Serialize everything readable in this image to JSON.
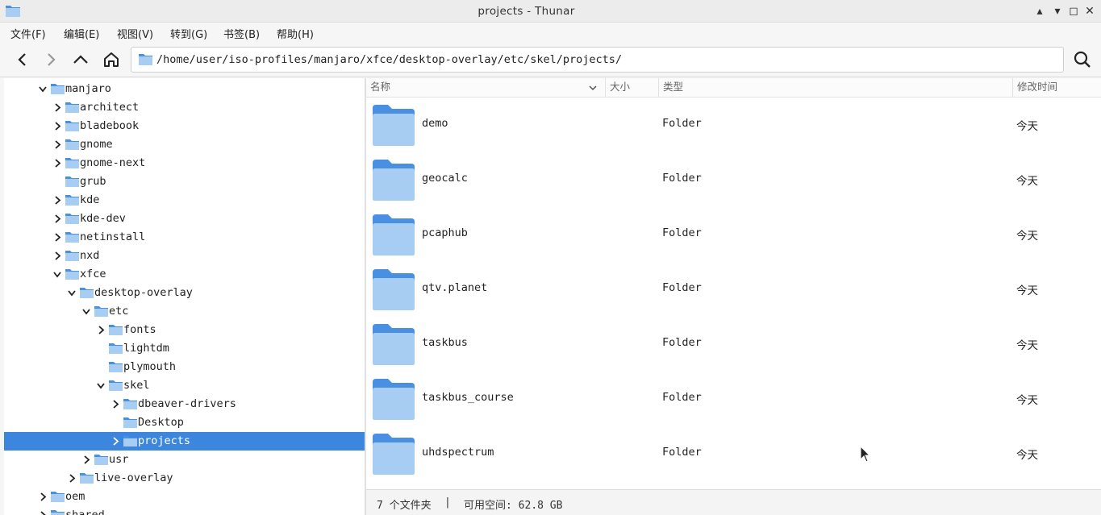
{
  "window": {
    "title": "projects - Thunar",
    "minimize_glyph": "▴",
    "restore_glyph": "▾",
    "maximize_glyph": "◻",
    "close_glyph": "✕"
  },
  "menubar": {
    "items": [
      "文件(F)",
      "编辑(E)",
      "视图(V)",
      "转到(G)",
      "书签(B)",
      "帮助(H)"
    ]
  },
  "toolbar": {
    "path": "/home/user/iso-profiles/manjaro/xfce/desktop-overlay/etc/skel/projects/"
  },
  "tree": {
    "items": [
      {
        "label": "manjaro",
        "state": "expanded"
      },
      {
        "label": "architect",
        "state": "collapsed"
      },
      {
        "label": "bladebook",
        "state": "collapsed"
      },
      {
        "label": "gnome",
        "state": "collapsed"
      },
      {
        "label": "gnome-next",
        "state": "collapsed"
      },
      {
        "label": "grub",
        "state": "leaf"
      },
      {
        "label": "kde",
        "state": "collapsed"
      },
      {
        "label": "kde-dev",
        "state": "collapsed"
      },
      {
        "label": "netinstall",
        "state": "collapsed"
      },
      {
        "label": "nxd",
        "state": "collapsed"
      },
      {
        "label": "xfce",
        "state": "expanded"
      },
      {
        "label": "desktop-overlay",
        "state": "expanded"
      },
      {
        "label": "etc",
        "state": "expanded"
      },
      {
        "label": "fonts",
        "state": "collapsed"
      },
      {
        "label": "lightdm",
        "state": "leaf"
      },
      {
        "label": "plymouth",
        "state": "leaf"
      },
      {
        "label": "skel",
        "state": "expanded"
      },
      {
        "label": "dbeaver-drivers",
        "state": "collapsed"
      },
      {
        "label": "Desktop",
        "state": "leaf"
      },
      {
        "label": "projects",
        "state": "collapsed",
        "selected": true
      },
      {
        "label": "usr",
        "state": "collapsed"
      },
      {
        "label": "live-overlay",
        "state": "collapsed"
      },
      {
        "label": "oem",
        "state": "collapsed"
      },
      {
        "label": "shared",
        "state": "collapsed"
      }
    ]
  },
  "columns": {
    "name": "名称",
    "size": "大小",
    "type": "类型",
    "modified": "修改时间"
  },
  "files": [
    {
      "name": "demo",
      "size": "",
      "type": "Folder",
      "modified": "今天"
    },
    {
      "name": "geocalc",
      "size": "",
      "type": "Folder",
      "modified": "今天"
    },
    {
      "name": "pcaphub",
      "size": "",
      "type": "Folder",
      "modified": "今天"
    },
    {
      "name": "qtv.planet",
      "size": "",
      "type": "Folder",
      "modified": "今天"
    },
    {
      "name": "taskbus",
      "size": "",
      "type": "Folder",
      "modified": "今天"
    },
    {
      "name": "taskbus_course",
      "size": "",
      "type": "Folder",
      "modified": "今天"
    },
    {
      "name": "uhdspectrum",
      "size": "",
      "type": "Folder",
      "modified": "今天"
    }
  ],
  "status": {
    "count": "7 个文件夹",
    "separator": "|",
    "free_space": "可用空间: 62.8 GB"
  },
  "colors": {
    "accent": "#3d86de",
    "folder_front": "#a8cdf3",
    "folder_back": "#4a90e2"
  },
  "icons": {
    "app": "folder-icon",
    "back": "arrow-left-icon",
    "forward": "arrow-right-icon",
    "up": "arrow-up-icon",
    "home": "home-icon",
    "search": "search-icon"
  }
}
